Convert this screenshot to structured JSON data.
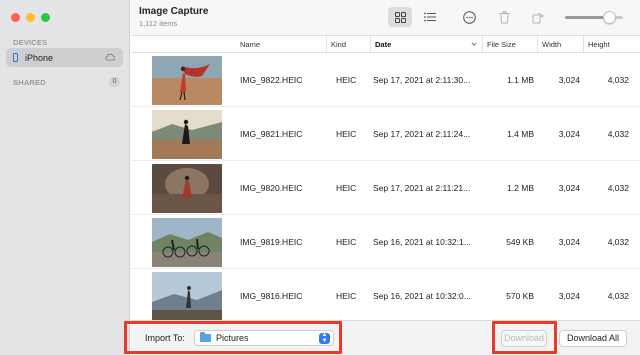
{
  "app": {
    "title": "Image Capture",
    "subtitle": "1,112 items"
  },
  "sidebar": {
    "devices_title": "DEVICES",
    "device": {
      "label": "iPhone",
      "icon": "iphone-icon"
    },
    "shared_title": "SHARED",
    "shared_count": "0"
  },
  "toolbar": {
    "view_grid_icon": "grid-view-icon",
    "view_list_icon": "list-view-icon",
    "more_icon": "more-options-icon",
    "delete_icon": "trash-icon",
    "rotate_icon": "rotate-icon",
    "thumbnail_size": 0.84
  },
  "table": {
    "columns": [
      "Name",
      "Kind",
      "Date",
      "File Size",
      "Width",
      "Height"
    ],
    "sorted_column": "Date",
    "rows": [
      {
        "name": "IMG_9822.HEIC",
        "kind": "HEIC",
        "date": "Sep 17, 2021 at 2:11:30...",
        "size": "1.1 MB",
        "width": "3,024",
        "height": "4,032"
      },
      {
        "name": "IMG_9821.HEIC",
        "kind": "HEIC",
        "date": "Sep 17, 2021 at 2:11:24...",
        "size": "1.4 MB",
        "width": "3,024",
        "height": "4,032"
      },
      {
        "name": "IMG_9820.HEIC",
        "kind": "HEIC",
        "date": "Sep 17, 2021 at 2:11:21...",
        "size": "1.2 MB",
        "width": "3,024",
        "height": "4,032"
      },
      {
        "name": "IMG_9819.HEIC",
        "kind": "HEIC",
        "date": "Sep 16, 2021 at 10:32:1...",
        "size": "549 KB",
        "width": "3,024",
        "height": "4,032"
      },
      {
        "name": "IMG_9816.HEIC",
        "kind": "HEIC",
        "date": "Sep 16, 2021 at 10:32:0...",
        "size": "570 KB",
        "width": "3,024",
        "height": "4,032"
      }
    ]
  },
  "bottom": {
    "import_label": "Import To:",
    "import_folder": "Pictures",
    "download_label": "Download",
    "download_all_label": "Download All"
  },
  "colors": {
    "highlight": "#e8392d",
    "accent": "#2f7bf2",
    "sidebar_bg": "#e4e4e6"
  }
}
